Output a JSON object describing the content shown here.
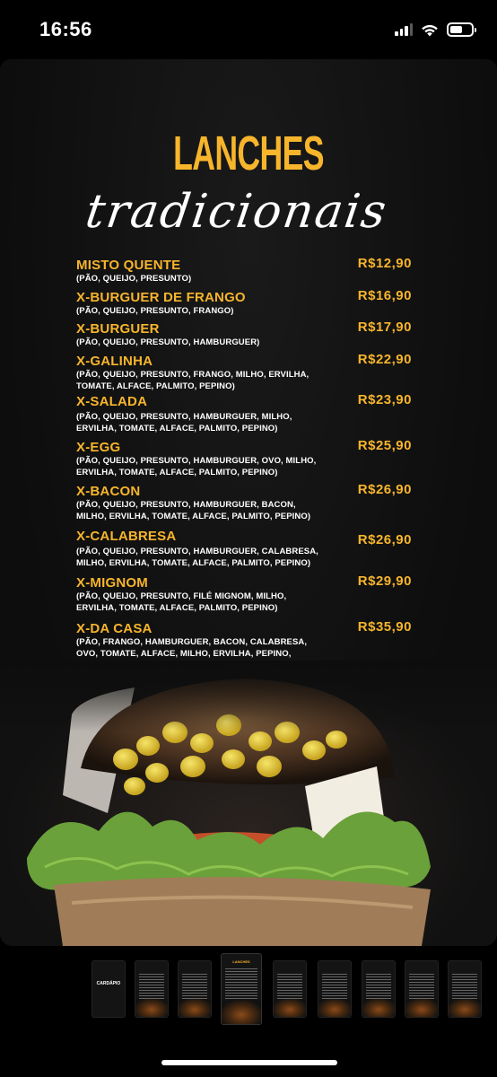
{
  "status_bar": {
    "time": "16:56"
  },
  "menu": {
    "title": "LANCHES",
    "subtitle": "tradicionais",
    "items": [
      {
        "name": "MISTO QUENTE",
        "desc": "(PÃO, QUEIJO, PRESUNTO)",
        "price": "R$12,90"
      },
      {
        "name": "X-BURGUER DE FRANGO",
        "desc": "(PÃO, QUEIJO, PRESUNTO, FRANGO)",
        "price": "R$16,90"
      },
      {
        "name": "X-BURGUER",
        "desc": "(PÃO, QUEIJO, PRESUNTO, HAMBURGUER)",
        "price": "R$17,90"
      },
      {
        "name": "X-GALINHA",
        "desc": "(PÃO, QUEIJO, PRESUNTO, FRANGO, MILHO, ERVILHA, TOMATE, ALFACE, PALMITO, PEPINO)",
        "price": "R$22,90"
      },
      {
        "name": "X-SALADA",
        "desc": "(PÃO, QUEIJO, PRESUNTO, HAMBURGUER, MILHO, ERVILHA, TOMATE, ALFACE, PALMITO, PEPINO)",
        "price": "R$23,90"
      },
      {
        "name": "X-EGG",
        "desc": "(PÃO, QUEIJO, PRESUNTO, HAMBURGUER, OVO, MILHO, ERVILHA, TOMATE, ALFACE, PALMITO, PEPINO)",
        "price": "R$25,90"
      },
      {
        "name": "X-BACON",
        "desc": "(PÃO, QUEIJO, PRESUNTO, HAMBURGUER, BACON, MILHO, ERVILHA, TOMATE, ALFACE, PALMITO, PEPINO)",
        "price": "R$26,90"
      },
      {
        "name": "X-CALABRESA",
        "desc": "(PÃO, QUEIJO, PRESUNTO, HAMBURGUER, CALABRESA, MILHO, ERVILHA, TOMATE, ALFACE, PALMITO, PEPINO)",
        "price": "R$26,90"
      },
      {
        "name": "X-MIGNOM",
        "desc": "(PÃO, QUEIJO, PRESUNTO, FILÉ MIGNOM, MILHO, ERVILHA, TOMATE, ALFACE, PALMITO, PEPINO)",
        "price": "R$29,90"
      },
      {
        "name": "X-DA CASA",
        "desc": "(PÃO, FRANGO, HAMBURGUER, BACON, CALABRESA, OVO, TOMATE, ALFACE, MILHO, ERVILHA, PEPINO, PALMITO)",
        "price": "R$35,90"
      }
    ]
  },
  "thumbnails": [
    {
      "title": "CARDÁPIO"
    },
    {
      "title": ""
    },
    {
      "title": ""
    },
    {
      "title": "LANCHES"
    },
    {
      "title": ""
    },
    {
      "title": ""
    },
    {
      "title": ""
    },
    {
      "title": ""
    },
    {
      "title": ""
    }
  ],
  "colors": {
    "accent": "#f7b52c",
    "background": "#0d0d0d"
  }
}
